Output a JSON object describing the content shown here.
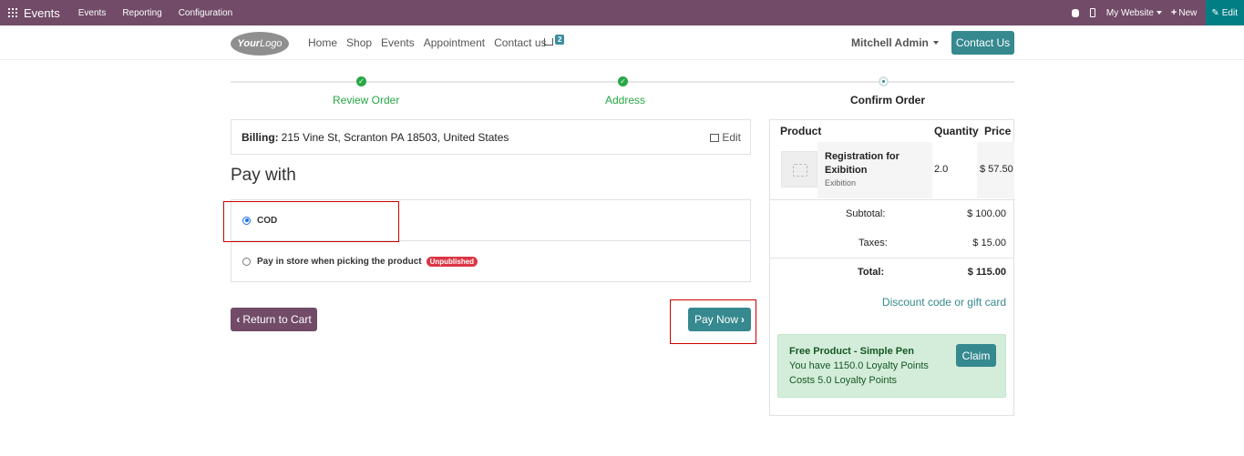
{
  "adminbar": {
    "app_name": "Events",
    "menu": [
      "Events",
      "Reporting",
      "Configuration"
    ],
    "website_label": "My Website",
    "new_label": "New",
    "edit_label": "Edit"
  },
  "header": {
    "logo_text_bold": "Your",
    "logo_text": "Logo",
    "nav": [
      "Home",
      "Shop",
      "Events",
      "Appointment",
      "Contact us"
    ],
    "cart_count": "2",
    "user_name": "Mitchell Admin",
    "contact_button": "Contact Us"
  },
  "wizard": {
    "steps": [
      {
        "label": "Review Order",
        "state": "done"
      },
      {
        "label": "Address",
        "state": "done"
      },
      {
        "label": "Confirm Order",
        "state": "active"
      }
    ]
  },
  "billing": {
    "label": "Billing:",
    "address": "215 Vine St, Scranton PA 18503, United States",
    "edit_label": "Edit"
  },
  "payment": {
    "heading": "Pay with",
    "options": [
      {
        "label": "COD",
        "selected": true,
        "badge": ""
      },
      {
        "label": "Pay in store when picking the product",
        "selected": false,
        "badge": "Unpublished"
      }
    ],
    "return_button": "Return to Cart",
    "pay_button": "Pay Now"
  },
  "summary": {
    "headers": {
      "product": "Product",
      "quantity": "Quantity",
      "price": "Price"
    },
    "items": [
      {
        "name": "Registration for Exibition",
        "subtitle": "Exibition",
        "quantity": "2.0",
        "price": "$ 57.50"
      }
    ],
    "subtotal_label": "Subtotal:",
    "subtotal": "$ 100.00",
    "taxes_label": "Taxes:",
    "taxes": "$ 15.00",
    "total_label": "Total:",
    "total": "$ 115.00",
    "discount_link": "Discount code or gift card",
    "loyalty": {
      "title": "Free Product - Simple Pen",
      "line1": "You have 1150.0 Loyalty Points",
      "line2": "Costs 5.0 Loyalty Points",
      "claim_button": "Claim"
    }
  },
  "colors": {
    "admin_bar": "#714b67",
    "primary": "#35898f",
    "success": "#28a745",
    "danger": "#dc3545"
  }
}
